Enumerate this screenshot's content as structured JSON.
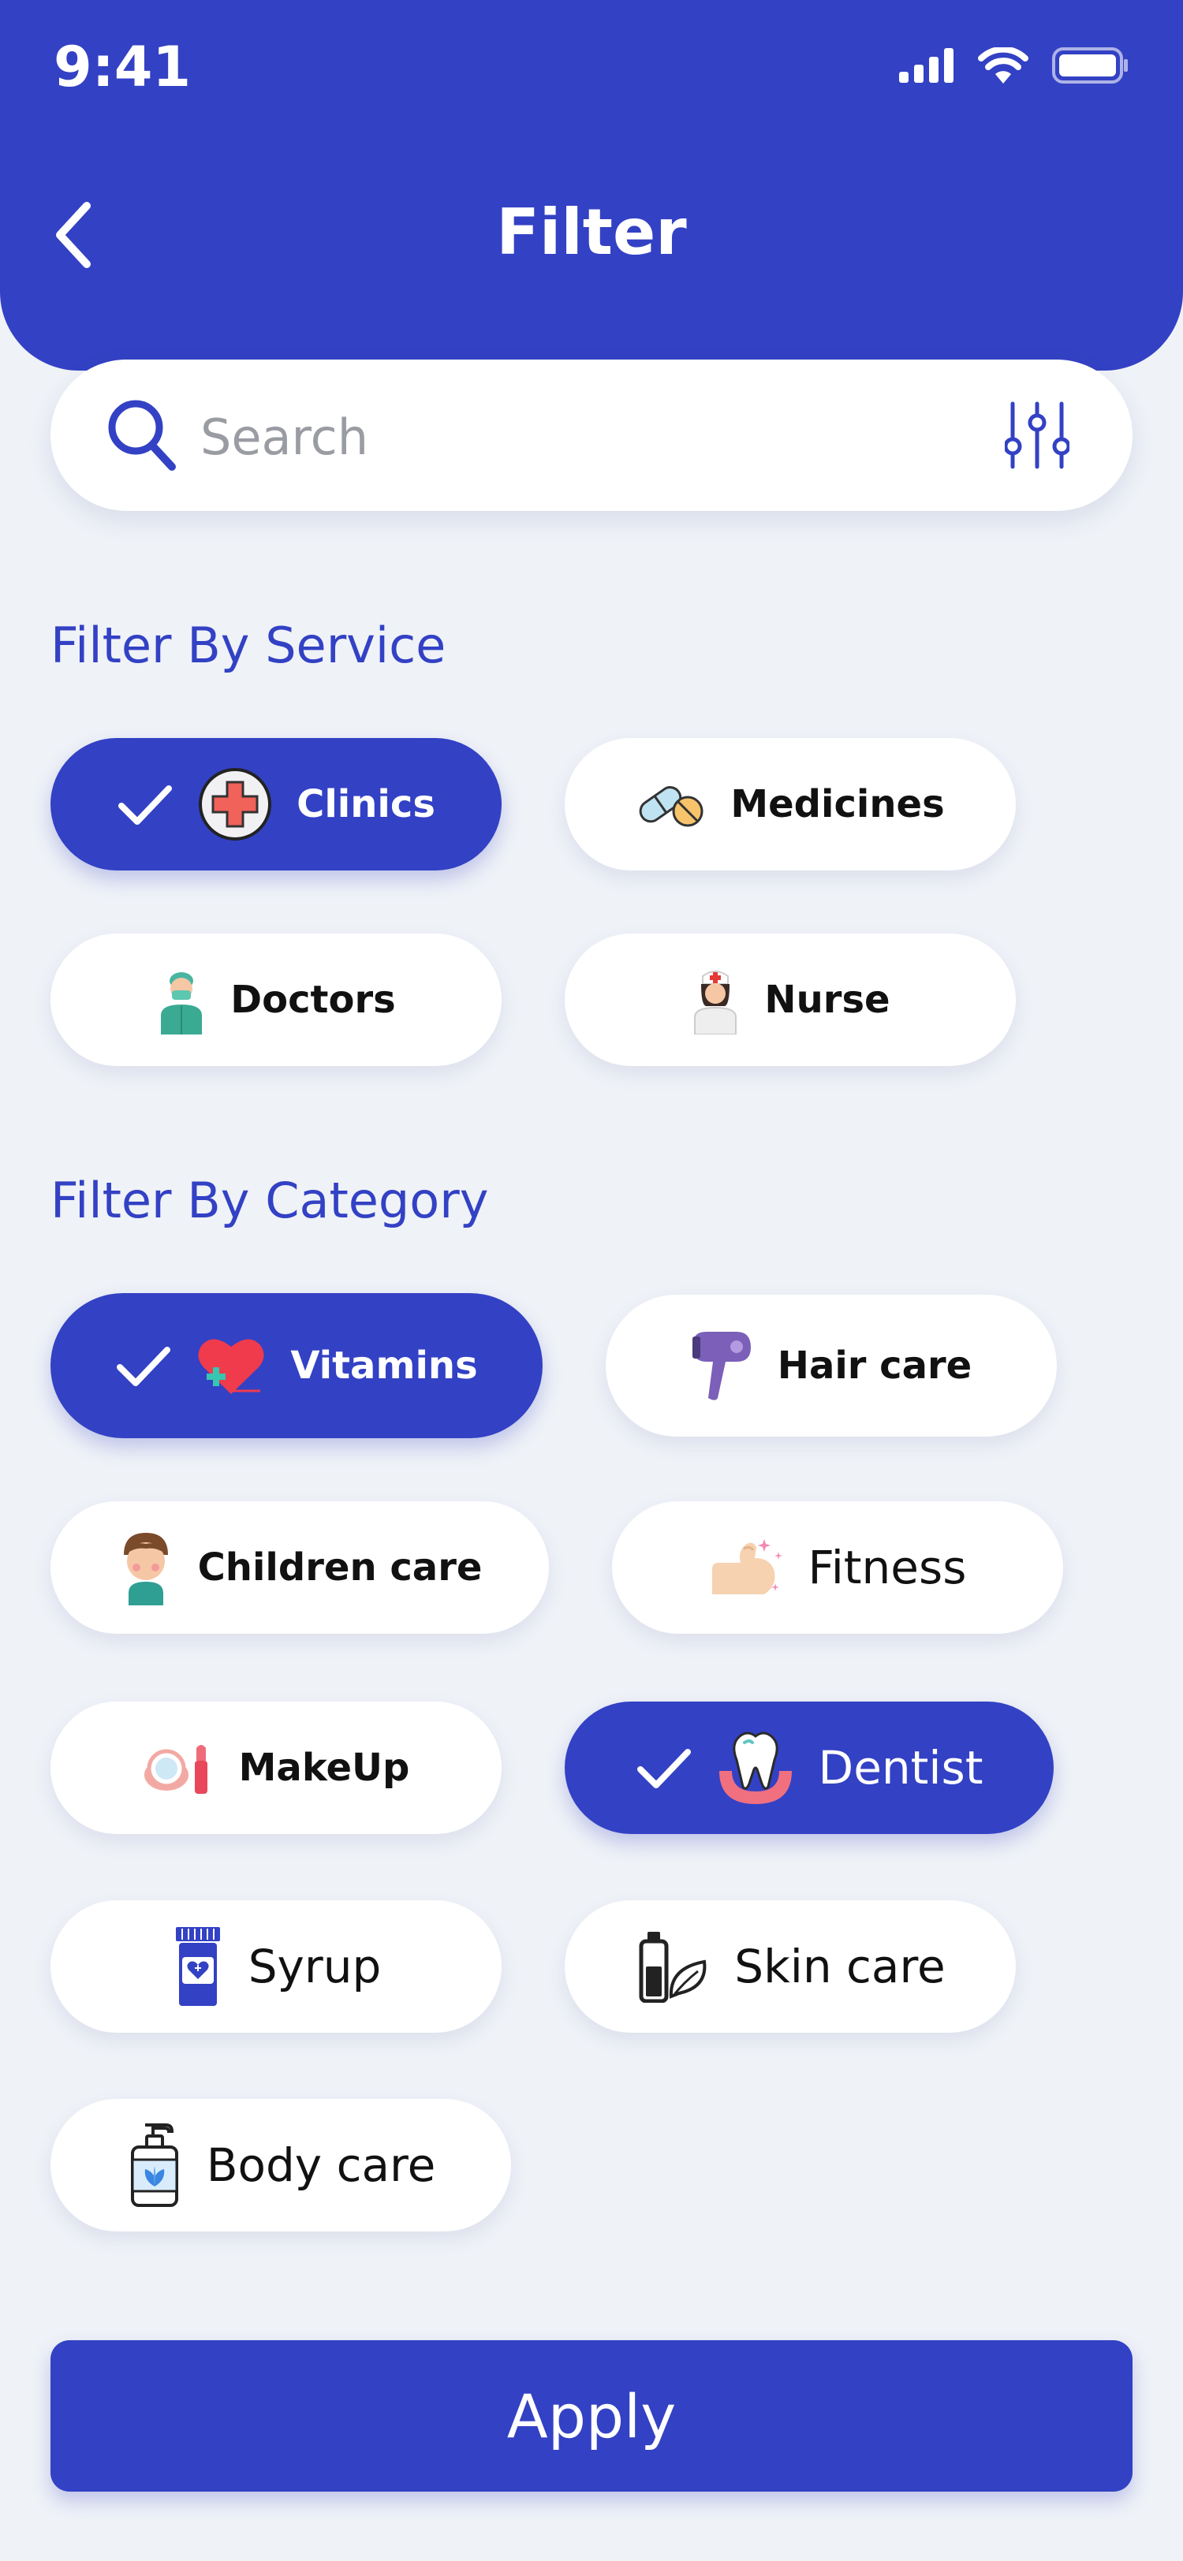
{
  "status_bar": {
    "time": "9:41"
  },
  "header": {
    "title": "Filter"
  },
  "search": {
    "placeholder": "Search"
  },
  "service_section": {
    "title": "Filter By Service",
    "items": [
      {
        "label": "Clinics",
        "selected": true,
        "icon": "clinic-cross-icon"
      },
      {
        "label": "Medicines",
        "selected": false,
        "icon": "pills-icon"
      },
      {
        "label": "Doctors",
        "selected": false,
        "icon": "doctor-icon"
      },
      {
        "label": "Nurse",
        "selected": false,
        "icon": "nurse-icon"
      }
    ]
  },
  "category_section": {
    "title": "Filter By Category",
    "items": [
      {
        "label": "Vitamins",
        "selected": true,
        "icon": "heart-plus-icon"
      },
      {
        "label": "Hair care",
        "selected": false,
        "icon": "hair-dryer-icon"
      },
      {
        "label": "Children care",
        "selected": false,
        "icon": "child-icon"
      },
      {
        "label": "Fitness",
        "selected": false,
        "icon": "muscle-arm-icon"
      },
      {
        "label": "MakeUp",
        "selected": false,
        "icon": "makeup-icon"
      },
      {
        "label": "Dentist",
        "selected": true,
        "icon": "tooth-icon"
      },
      {
        "label": "Syrup",
        "selected": false,
        "icon": "syrup-bottle-icon"
      },
      {
        "label": "Skin care",
        "selected": false,
        "icon": "skin-care-icon"
      },
      {
        "label": "Body care",
        "selected": false,
        "icon": "pump-bottle-icon"
      }
    ]
  },
  "apply_button": {
    "label": "Apply"
  },
  "colors": {
    "primary": "#3341c4",
    "background": "#eff2f7",
    "chip": "#ffffff"
  }
}
